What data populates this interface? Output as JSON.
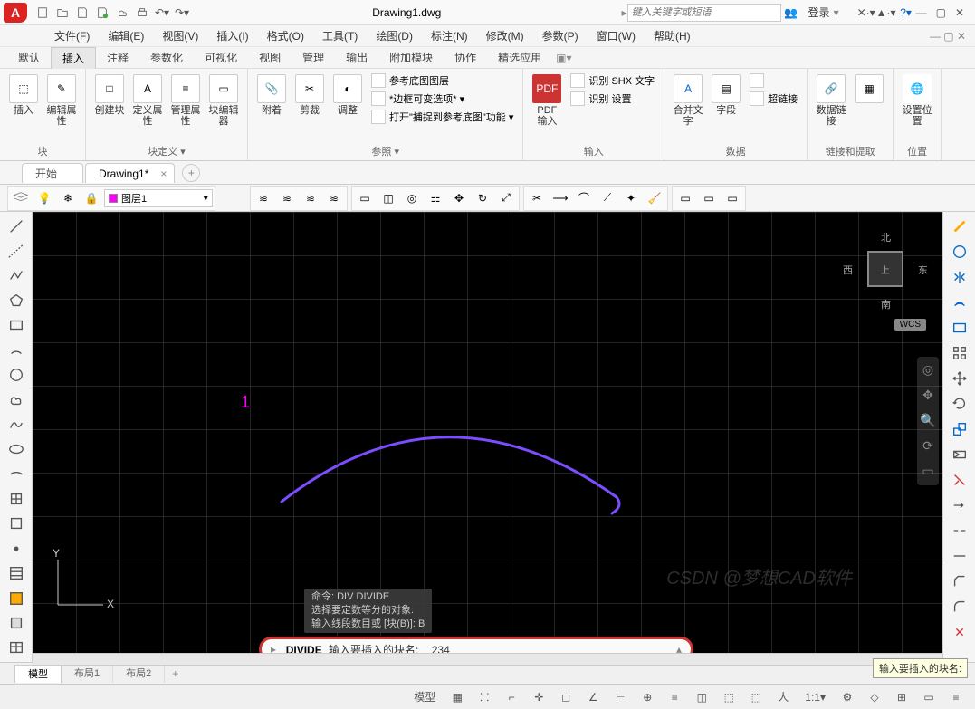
{
  "title_file": "Drawing1.dwg",
  "search_placeholder": "键入关键字或短语",
  "login_label": "登录",
  "menus": [
    "文件(F)",
    "编辑(E)",
    "视图(V)",
    "插入(I)",
    "格式(O)",
    "工具(T)",
    "绘图(D)",
    "标注(N)",
    "修改(M)",
    "参数(P)",
    "窗口(W)",
    "帮助(H)"
  ],
  "ribbon_tabs": [
    "默认",
    "插入",
    "注释",
    "参数化",
    "可视化",
    "视图",
    "管理",
    "输出",
    "附加模块",
    "协作",
    "精选应用"
  ],
  "ribbon_active": 1,
  "panels": {
    "block": {
      "title": "块",
      "btns": [
        "插入",
        "编辑属性",
        "创建块",
        "定义属性",
        "管理属性",
        "块编辑器"
      ]
    },
    "blockdef": {
      "title": "块定义 ▾"
    },
    "ref": {
      "title": "参照 ▾",
      "btns": [
        "附着",
        "剪裁",
        "调整"
      ],
      "links": [
        "参考底图图层",
        "*边框可变选项* ▾",
        "打开\"捕捉到参考底图\"功能 ▾"
      ]
    },
    "import": {
      "title": "输入",
      "btns": [
        "PDF 输入"
      ],
      "links": [
        "识别 SHX 文字",
        "识别 设置"
      ]
    },
    "data": {
      "title": "数据",
      "btns": [
        "合并文字",
        "字段",
        "超链接"
      ]
    },
    "link": {
      "title": "链接和提取",
      "btns": [
        "数据链接"
      ]
    },
    "loc": {
      "title": "位置",
      "btns": [
        "设置位置"
      ]
    }
  },
  "doc_tabs": [
    {
      "label": "开始",
      "active": false
    },
    {
      "label": "Drawing1*",
      "active": true
    }
  ],
  "layer_current": "图层1",
  "canvas": {
    "marker": "1",
    "viewcube": {
      "n": "北",
      "s": "南",
      "e": "东",
      "w": "西",
      "face": "上"
    },
    "wcs": "WCS",
    "ucs": {
      "x": "X",
      "y": "Y"
    }
  },
  "cmd_history": [
    "命令: DIV DIVIDE",
    "选择要定数等分的对象:",
    "输入线段数目或 [块(B)]: B"
  ],
  "cmd_line": {
    "cmd": "DIVIDE",
    "prompt": "输入要插入的块名:",
    "input": "234"
  },
  "layout_tabs": [
    "模型",
    "布局1",
    "布局2"
  ],
  "status_model": "模型",
  "tooltip": "输入要插入的块名:",
  "watermark": "CSDN @梦想CAD软件"
}
